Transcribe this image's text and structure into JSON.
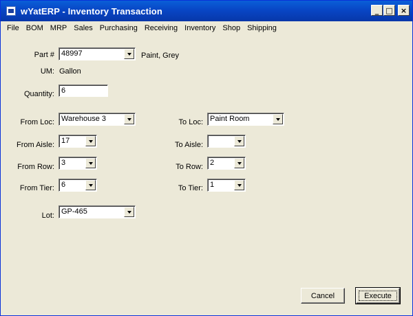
{
  "window": {
    "title": "wYatERP - Inventory Transaction",
    "controls": {
      "minimize": "_",
      "maximize": "□",
      "close": "×"
    }
  },
  "menu": [
    "File",
    "BOM",
    "MRP",
    "Sales",
    "Purchasing",
    "Receiving",
    "Inventory",
    "Shop",
    "Shipping"
  ],
  "form": {
    "part_label": "Part #",
    "part_value": "48997",
    "part_description": "Paint, Grey",
    "um_label": "UM:",
    "um_value": "Gallon",
    "quantity_label": "Quantity:",
    "quantity_value": "6",
    "from_loc_label": "From Loc:",
    "from_loc_value": "Warehouse 3",
    "to_loc_label": "To Loc:",
    "to_loc_value": "Paint Room",
    "from_aisle_label": "From Aisle:",
    "from_aisle_value": "17",
    "to_aisle_label": "To Aisle:",
    "to_aisle_value": "",
    "from_row_label": "From Row:",
    "from_row_value": "3",
    "to_row_label": "To Row:",
    "to_row_value": "2",
    "from_tier_label": "From Tier:",
    "from_tier_value": "6",
    "to_tier_label": "To Tier:",
    "to_tier_value": "1",
    "lot_label": "Lot:",
    "lot_value": "GP-465"
  },
  "buttons": {
    "cancel": "Cancel",
    "execute": "Execute"
  }
}
